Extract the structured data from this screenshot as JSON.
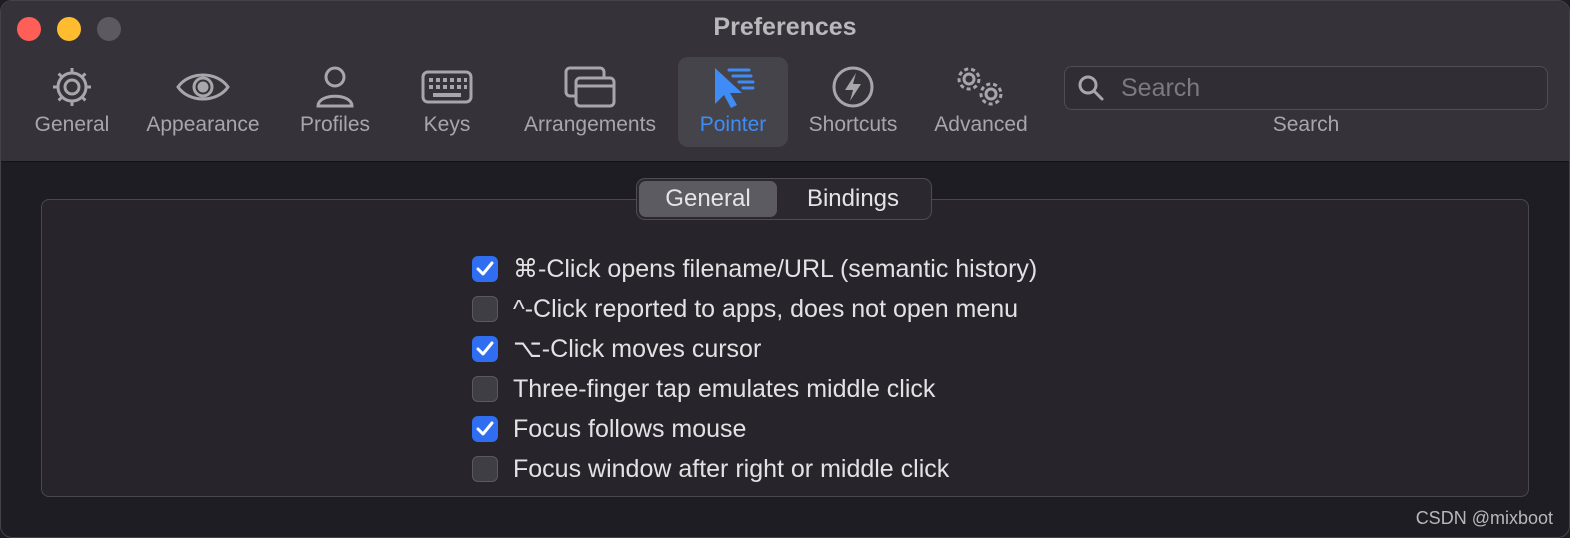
{
  "window": {
    "title": "Preferences"
  },
  "toolbar": {
    "items": [
      {
        "label": "General",
        "icon": "gear-icon"
      },
      {
        "label": "Appearance",
        "icon": "eye-icon"
      },
      {
        "label": "Profiles",
        "icon": "person-icon"
      },
      {
        "label": "Keys",
        "icon": "keyboard-icon"
      },
      {
        "label": "Arrangements",
        "icon": "windows-icon"
      },
      {
        "label": "Pointer",
        "icon": "pointer-icon",
        "selected": true
      },
      {
        "label": "Shortcuts",
        "icon": "bolt-icon"
      },
      {
        "label": "Advanced",
        "icon": "gears-icon"
      }
    ],
    "search": {
      "placeholder": "Search",
      "caption": "Search"
    }
  },
  "tabs": {
    "items": [
      "General",
      "Bindings"
    ],
    "selected": "General"
  },
  "options": [
    {
      "label": "⌘-Click opens filename/URL (semantic history)",
      "checked": true
    },
    {
      "label": "^-Click reported to apps, does not open menu",
      "checked": false
    },
    {
      "label": "⌥-Click moves cursor",
      "checked": true
    },
    {
      "label": "Three-finger tap emulates middle click",
      "checked": false
    },
    {
      "label": "Focus follows mouse",
      "checked": true
    },
    {
      "label": "Focus window after right or middle click",
      "checked": false
    }
  ],
  "watermark": "CSDN @mixboot",
  "colors": {
    "accent": "#3f8cf6",
    "checkbox": "#2f6ef0",
    "close": "#ff5f57",
    "minimize": "#febc2e"
  }
}
